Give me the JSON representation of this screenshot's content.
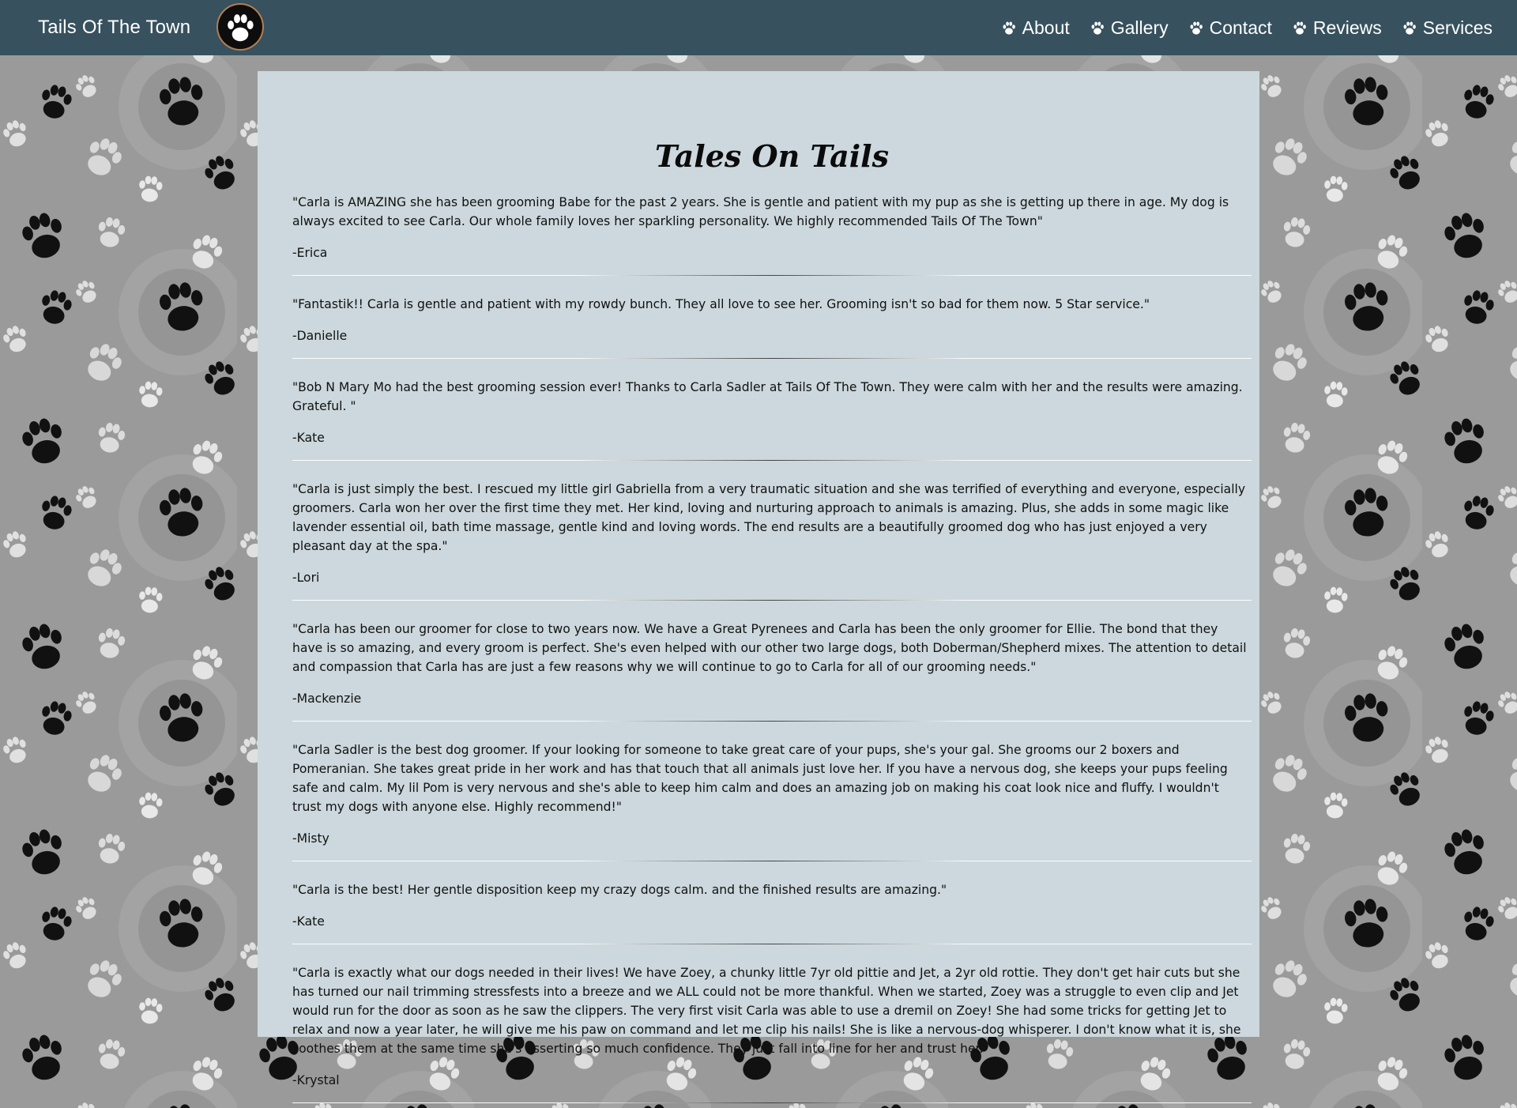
{
  "header": {
    "brand": "Tails Of The Town",
    "logo_icon": "paw-icon",
    "nav": [
      {
        "label": "About",
        "icon": "paw-icon"
      },
      {
        "label": "Gallery",
        "icon": "paw-icon"
      },
      {
        "label": "Contact",
        "icon": "paw-icon"
      },
      {
        "label": "Reviews",
        "icon": "paw-icon"
      },
      {
        "label": "Services",
        "icon": "paw-icon"
      }
    ]
  },
  "colors": {
    "navbar": "#37515e",
    "panel": "#ccd8dd",
    "background": "#9a9a9a",
    "logo_ring": "#b27f52"
  },
  "main": {
    "title": "Tales On Tails",
    "reviews": [
      {
        "text": "\"Carla is AMAZING she has been grooming Babe for the past 2 years. She is gentle and patient with my pup as she is getting up there in age. My dog is always excited to see Carla. Our whole family loves her sparkling personality. We highly recommended Tails Of The Town\"",
        "author": "-Erica"
      },
      {
        "text": "\"Fantastik!! Carla is gentle and patient with my rowdy bunch. They all love to see her. Grooming isn't so bad for them now. 5 Star service.\"",
        "author": "-Danielle"
      },
      {
        "text": "\"Bob N Mary Mo had the best grooming session ever! Thanks to Carla Sadler at Tails Of The Town. They were calm with her and the results were amazing. Grateful. \"",
        "author": "-Kate"
      },
      {
        "text": "\"Carla is just simply the best. I rescued my little girl Gabriella from a very traumatic situation and she was terrified of everything and everyone, especially groomers. Carla won her over the first time they met. Her kind, loving and nurturing approach to animals is amazing. Plus, she adds in some magic like lavender essential oil, bath time massage, gentle kind and loving words. The end results are a beautifully groomed dog who has just enjoyed a very pleasant day at the spa.\"",
        "author": "-Lori"
      },
      {
        "text": "\"Carla has been our groomer for close to two years now. We have a Great Pyrenees and Carla has been the only groomer for Ellie. The bond that they have is so amazing, and every groom is perfect. She's even helped with our other two large dogs, both Doberman/Shepherd mixes. The attention to detail and compassion that Carla has are just a few reasons why we will continue to go to Carla for all of our grooming needs.\"",
        "author": "-Mackenzie"
      },
      {
        "text": "\"Carla Sadler is the best dog groomer. If your looking for someone to take great care of your pups, she's your gal. She grooms our 2 boxers and Pomeranian. She takes great pride in her work and has that touch that all animals just love her. If you have a nervous dog, she keeps your pups feeling safe and calm. My lil Pom is very nervous and she's able to keep him calm and does an amazing job on making his coat look nice and fluffy. I wouldn't trust my dogs with anyone else. Highly recommend!\"",
        "author": "-Misty"
      },
      {
        "text": "\"Carla is the best! Her gentle disposition keep my crazy dogs calm. and the finished results are amazing.\"",
        "author": "-Kate"
      },
      {
        "text": "\"Carla is exactly what our dogs needed in their lives! We have Zoey, a chunky little 7yr old pittie and Jet, a 2yr old rottie. They don't get hair cuts but she has turned our nail trimming stressfests into a breeze and we ALL could not be more thankful. When we started, Zoey was a struggle to even clip and Jet would run for the door as soon as he saw the clippers. The very first visit Carla was able to use a dremil on Zoey! She had some tricks for getting Jet to relax and now a year later, he will give me his paw on command and let me clip his nails! She is like a nervous-dog whisperer. I don't know what it is, she soothes them at the same time she's asserting so much confidence. They just fall into line for her and trust her.\"",
        "author": "-Krystal"
      }
    ]
  }
}
